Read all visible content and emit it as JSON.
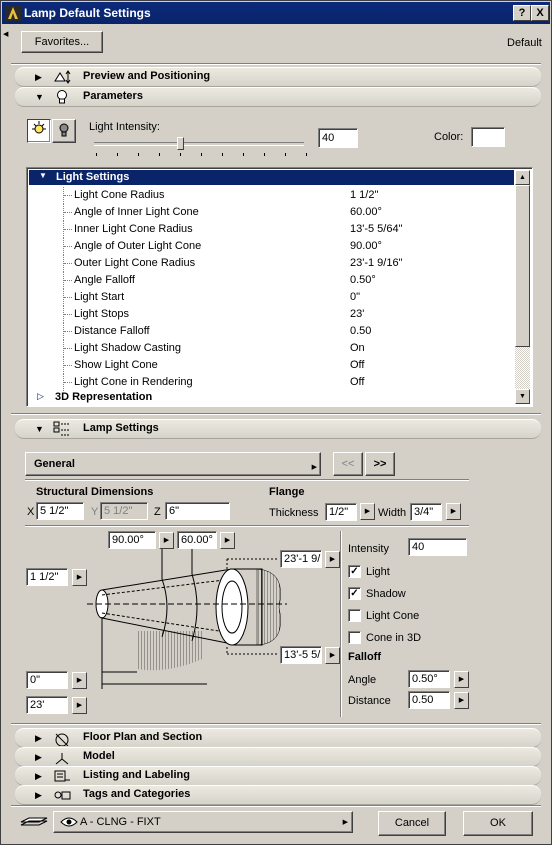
{
  "window": {
    "title": "Lamp Default Settings",
    "help": "?",
    "close": "X"
  },
  "top": {
    "favorites": "Favorites...",
    "default_label": "Default"
  },
  "sections": {
    "preview": "Preview and Positioning",
    "parameters": "Parameters",
    "lamp_settings": "Lamp Settings",
    "floor_plan": "Floor Plan and Section",
    "model": "Model",
    "listing": "Listing and Labeling",
    "tags": "Tags and Categories"
  },
  "parameters": {
    "light_intensity_label": "Light Intensity:",
    "light_intensity_value": "40",
    "intensity_fraction": 0.4,
    "color_label": "Color:"
  },
  "light_settings": {
    "header": "Light Settings",
    "rows": [
      {
        "k": "Light Cone Radius",
        "v": "1 1/2\""
      },
      {
        "k": "Angle of Inner Light Cone",
        "v": "60.00°"
      },
      {
        "k": "Inner Light Cone Radius",
        "v": "13'-5 5/64\""
      },
      {
        "k": "Angle of Outer Light Cone",
        "v": "90.00°"
      },
      {
        "k": "Outer Light Cone Radius",
        "v": "23'-1 9/16\""
      },
      {
        "k": "Angle Falloff",
        "v": "0.50°"
      },
      {
        "k": "Light Start",
        "v": "0\""
      },
      {
        "k": "Light Stops",
        "v": "23'"
      },
      {
        "k": "Distance Falloff",
        "v": "0.50"
      },
      {
        "k": "Light Shadow Casting",
        "v": "On"
      },
      {
        "k": "Show Light Cone",
        "v": "Off"
      },
      {
        "k": "Light Cone in Rendering",
        "v": "Off"
      }
    ],
    "rep3d": "3D Representation"
  },
  "lamp": {
    "dropdown": "General",
    "prev": "<<",
    "next": ">>",
    "structural_title": "Structural Dimensions",
    "flange_title": "Flange",
    "x_label": "X",
    "x_val": "5 1/2\"",
    "y_label": "Y",
    "y_val": "5 1/2\"",
    "z_label": "Z",
    "z_val": "6\"",
    "thickness_label": "Thickness",
    "thickness_val": "1/2\"",
    "width_label": "Width",
    "width_val": "3/4\"",
    "outer_angle": "90.00°",
    "inner_angle": "60.00°",
    "outer_radius": "23'-1 9/",
    "inner_radius": "13'-5 5/",
    "cone_radius": "1 1/2\"",
    "light_start": "0\"",
    "light_stop": "23'",
    "intensity_label": "Intensity",
    "intensity_val": "40",
    "light_label": "Light",
    "light_checked": true,
    "shadow_label": "Shadow",
    "shadow_checked": true,
    "cone_label": "Light Cone",
    "cone_checked": false,
    "cone3d_label": "Cone in 3D",
    "cone3d_checked": false,
    "falloff_title": "Falloff",
    "angle_label": "Angle",
    "angle_val": "0.50°",
    "distance_label": "Distance",
    "distance_val": "0.50"
  },
  "bottom": {
    "layer": "A - CLNG - FIXT",
    "cancel": "Cancel",
    "ok": "OK"
  },
  "glyphs": {
    "check": "✓",
    "tri_right": "▶",
    "tri_down": "▼",
    "arrow_right": "▶",
    "arrow_up": "▲",
    "arrow_down": "▼"
  }
}
